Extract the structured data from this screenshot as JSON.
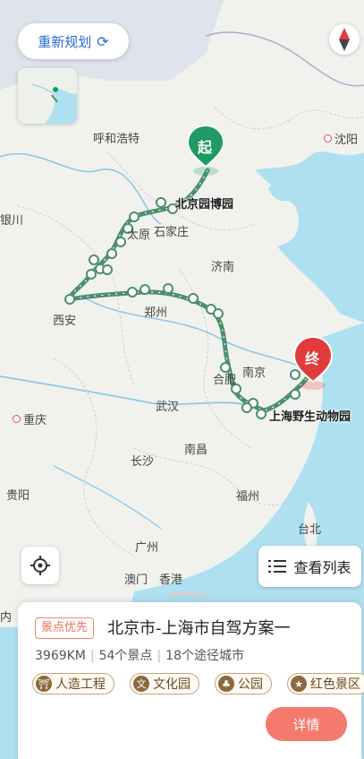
{
  "top": {
    "replan_label": "重新规划",
    "replan_icon": "refresh-icon",
    "compass_icon": "compass-icon"
  },
  "map": {
    "cities": {
      "hohhot": "呼和浩特",
      "shenyang": "沈阳",
      "taiyuan": "太原",
      "shijiazhuang": "石家庄",
      "jinan": "济南",
      "xian": "西安",
      "zhengzhou": "郑州",
      "nanjing": "南京",
      "hefei": "合肥",
      "wuhan": "武汉",
      "chongqing": "重庆",
      "changsha": "长沙",
      "nanchang": "南昌",
      "guiyang": "贵阳",
      "fuzhou": "福州",
      "taibei": "台北",
      "guangzhou": "广州",
      "aomen": "澳门",
      "xianggang": "香港",
      "yinchuan_partial": "银川",
      "nei_partial": "内"
    },
    "start_marker": "起",
    "end_marker": "终",
    "start_poi": "北京园博园",
    "end_poi": "上海野生动物园",
    "route_color": "#4c8e6e",
    "start_color": "#1e9a62",
    "end_color": "#e23b3b"
  },
  "controls": {
    "locate_icon": "locate-icon",
    "list_label": "查看列表",
    "list_icon": "list-icon"
  },
  "card": {
    "badge": "景点优先",
    "title": "北京市-上海市自驾方案一",
    "distance": "3969KM",
    "spots": "54个景点",
    "cities": "18个途径城市",
    "tags": [
      {
        "label": "人造工程",
        "icon": "landmark-icon"
      },
      {
        "label": "文化园",
        "icon": "culture-icon"
      },
      {
        "label": "公园",
        "icon": "park-icon"
      },
      {
        "label": "红色景区",
        "icon": "red-site-icon"
      }
    ],
    "detail_label": "详情"
  }
}
